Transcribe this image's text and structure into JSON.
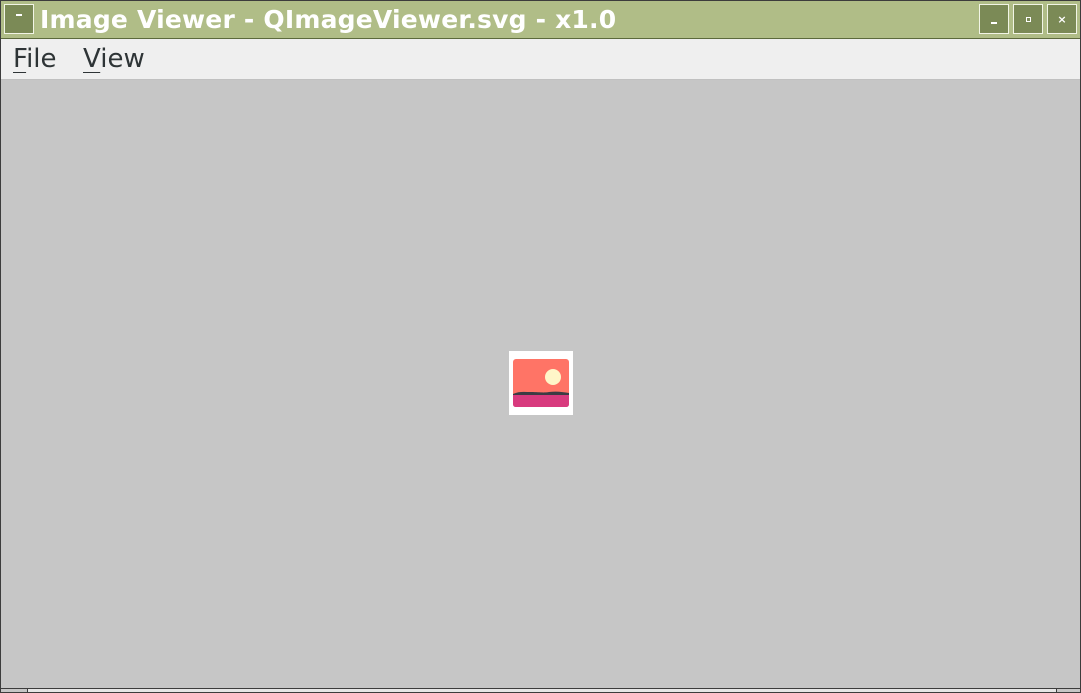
{
  "window": {
    "title": "Image Viewer - QImageViewer.svg - x1.0",
    "controls": {
      "window_menu": "window-menu-icon",
      "minimize": "minimize-icon",
      "maximize": "maximize-icon",
      "close": "close-icon"
    },
    "title_bar_color": "#b0bd87"
  },
  "menubar": {
    "items": [
      {
        "label": "File",
        "mnemonic": "F",
        "rest": "ile"
      },
      {
        "label": "View",
        "mnemonic": "V",
        "rest": "iew"
      }
    ]
  },
  "viewer": {
    "background_color": "#c6c6c6",
    "image": {
      "icon": "landscape-image-icon",
      "colors": {
        "sky": "#ff7466",
        "sun": "#fff6c8",
        "hills": "#3c3b43",
        "ground": "#d83a7e",
        "frame": "#ffffff"
      }
    }
  }
}
